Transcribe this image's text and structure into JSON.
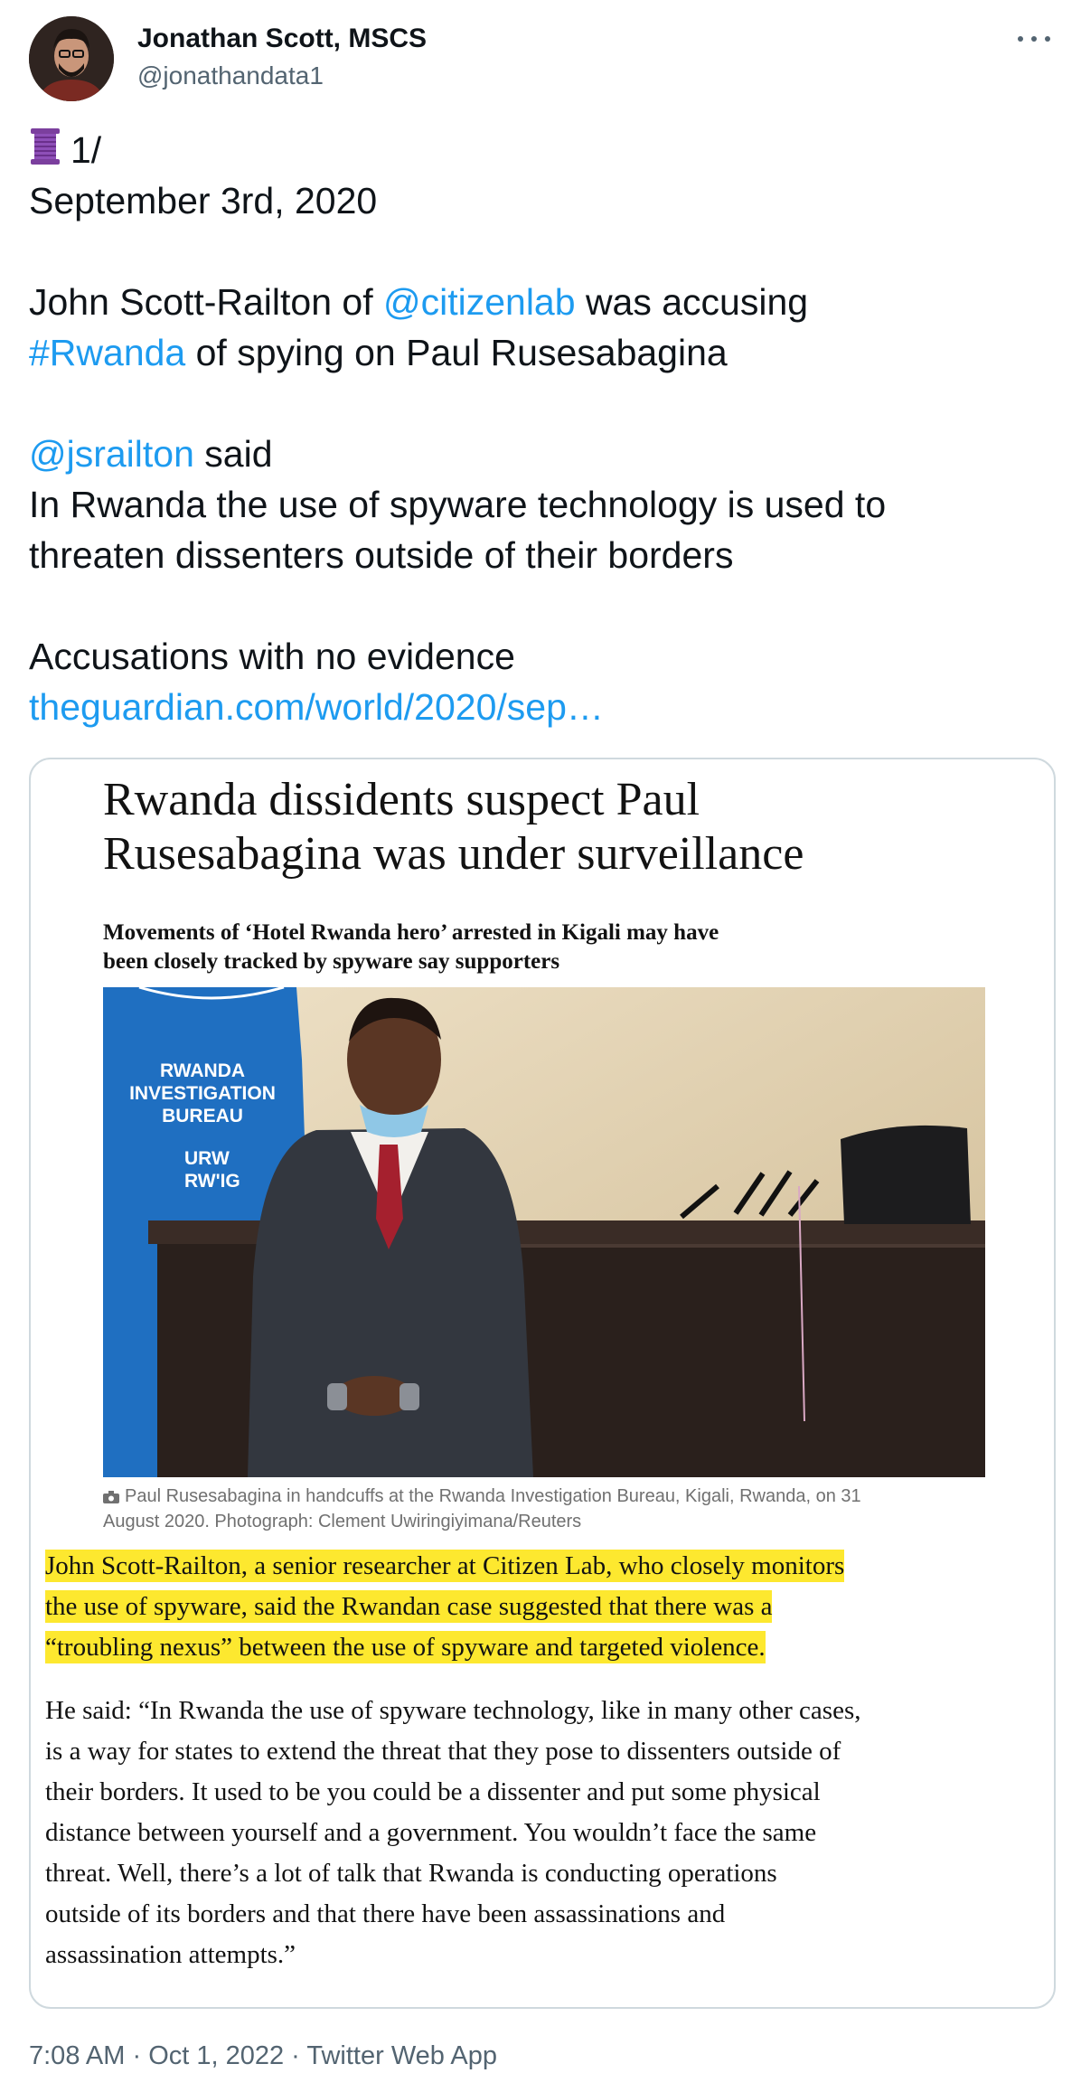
{
  "tweet": {
    "author": {
      "name": "Jonathan Scott, MSCS",
      "handle": "@jonathandata1"
    },
    "more_icon": "more-horizontal-icon",
    "thread_icon": "spool-of-thread-emoji",
    "counter": "1/",
    "date_line": "September 3rd, 2020",
    "p1": {
      "before": "John Scott-Railton of ",
      "mention": "@citizenlab",
      "after": " was accusing",
      "hashtag": "#Rwanda",
      "rest": " of spying on Paul Rusesabagina"
    },
    "p2": {
      "mention": "@jsrailton",
      "said": " said",
      "line2": "In Rwanda the use of spyware technology is used to",
      "line3": "threaten dissenters outside of their borders"
    },
    "p3": {
      "line1": "Accusations with no evidence",
      "url": "theguardian.com/world/2020/sep…"
    },
    "footer": {
      "time": "7:08 AM",
      "sep1": " · ",
      "date": "Oct 1, 2022",
      "sep2": " · ",
      "source": "Twitter Web App"
    }
  },
  "article": {
    "headline_l1": "Rwanda dissidents suspect Paul",
    "headline_l2": "Rusesabagina was under surveillance",
    "standfirst_l1": "Movements of ‘Hotel Rwanda hero’ arrested in Kigali may have",
    "standfirst_l2": "been closely tracked by spyware say supporters",
    "photo": {
      "sign_l1": "RWANDA",
      "sign_l2": "INVESTIGATION",
      "sign_l3": "BUREAU",
      "sign_l4": "URW",
      "sign_l5": "RW'IG"
    },
    "caption_l1": "Paul Rusesabagina in handcuffs at the Rwanda Investigation Bureau, Kigali, Rwanda, on 31",
    "caption_l2": "August 2020. Photograph: Clement Uwiringiyimana/Reuters",
    "highlight_l1": "John Scott-Railton, a senior researcher at Citizen Lab, who closely monitors",
    "highlight_l2": "the use of spyware, said the Rwandan case suggested that there was a",
    "highlight_l3": "“troubling nexus” between the use of spyware and targeted violence.",
    "quote_l1": "He said: “In Rwanda the use of spyware technology, like in many other cases,",
    "quote_l2": "is a way for states to extend the threat that they pose to dissenters outside of",
    "quote_l3": "their borders. It used to be you could be a dissenter and put some physical",
    "quote_l4": "distance between yourself and a government. You wouldn’t face the same",
    "quote_l5": "threat. Well, there’s a lot of talk that Rwanda is conducting operations",
    "quote_l6": "outside of its borders and that there have been assassinations and",
    "quote_l7": "assassination attempts.”"
  },
  "colors": {
    "link": "#1d9bf0",
    "highlight": "#fde82f",
    "muted": "#536471",
    "border": "#cfd9de"
  }
}
